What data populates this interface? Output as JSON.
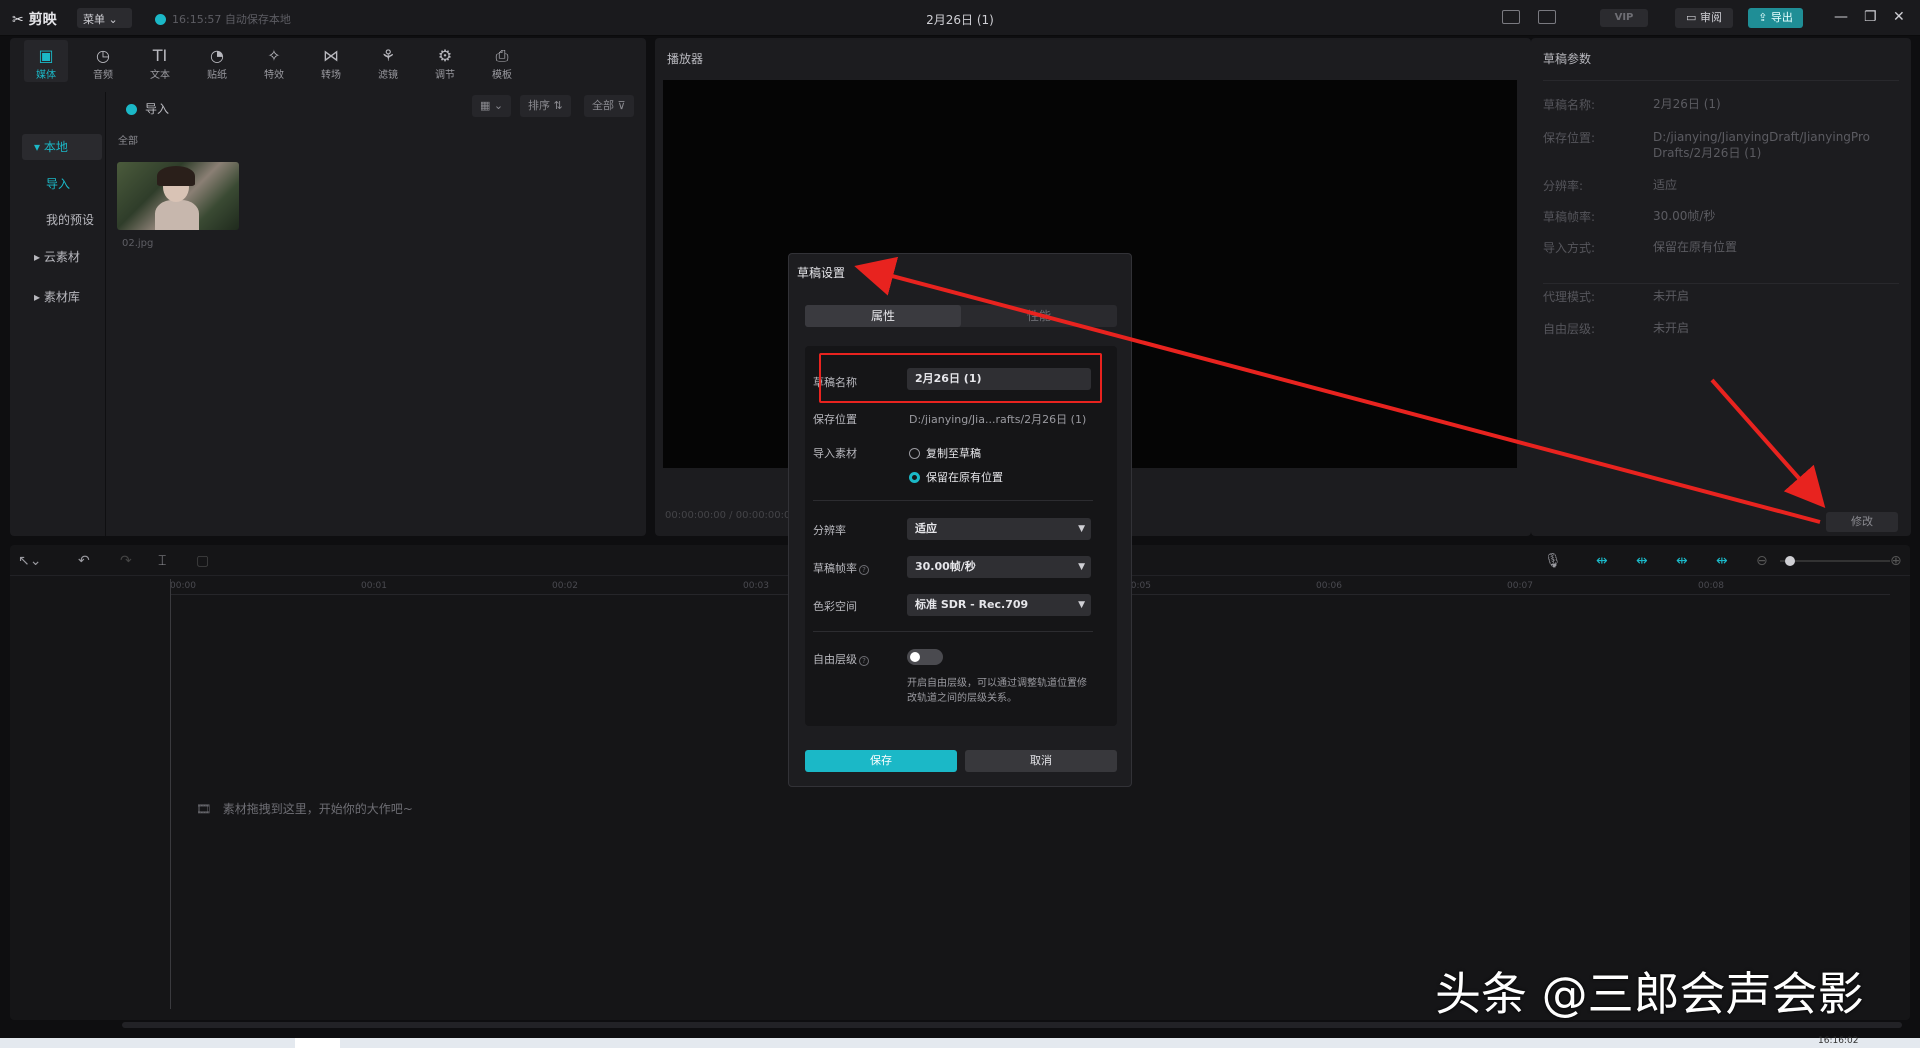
{
  "app": {
    "logo": "剪映",
    "menu_label": "菜单",
    "autosave": "16:15:57 自动保存本地",
    "doc_title": "2月26日 (1)",
    "vip": "VIP",
    "review": "审阅",
    "export": "导出"
  },
  "toolbar": [
    "媒体",
    "音频",
    "文本",
    "贴纸",
    "特效",
    "转场",
    "滤镜",
    "调节",
    "模板"
  ],
  "toolbar_icons": [
    "media-icon",
    "audio-icon",
    "text-icon",
    "sticker-icon",
    "effects-icon",
    "transition-icon",
    "filter-icon",
    "adjust-icon",
    "template-icon"
  ],
  "sidebar": {
    "local": "本地",
    "import": "导入",
    "presets": "我的预设",
    "cloud": "云素材",
    "library": "素材库"
  },
  "media": {
    "import_label": "导入",
    "sort_label": "排序",
    "all_filter": "全部",
    "all_heading": "全部",
    "file_name": "02.jpg"
  },
  "player": {
    "title": "播放器",
    "timecode": "00:00:00:00 / 00:00:00:00"
  },
  "params": {
    "title": "草稿参数",
    "rows": [
      {
        "k": "草稿名称:",
        "v": "2月26日 (1)"
      },
      {
        "k": "保存位置:",
        "v": "D:/jianying/JianyingDraft/JianyingPro Drafts/2月26日 (1)"
      },
      {
        "k": "分辨率:",
        "v": "适应"
      },
      {
        "k": "草稿帧率:",
        "v": "30.00帧/秒"
      },
      {
        "k": "导入方式:",
        "v": "保留在原有位置"
      },
      {
        "k": "代理模式:",
        "v": "未开启"
      },
      {
        "k": "自由层级:",
        "v": "未开启"
      }
    ],
    "modify": "修改"
  },
  "timeline": {
    "ticks": [
      "00:00",
      "00:01",
      "00:02",
      "00:03",
      "00:04",
      "00:05",
      "00:06",
      "00:07",
      "00:08"
    ],
    "drop_hint": "素材拖拽到这里，开始你的大作吧~"
  },
  "dialog": {
    "title": "草稿设置",
    "tab_props": "属性",
    "tab_other": "性能",
    "name_label": "草稿名称",
    "name_value": "2月26日 (1)",
    "path_label": "保存位置",
    "path_value": "D:/jianying/Jia...rafts/2月26日 (1)",
    "import_label": "导入素材",
    "opt_copy": "复制至草稿",
    "opt_keep": "保留在原有位置",
    "res_label": "分辨率",
    "res_value": "适应",
    "fps_label": "草稿帧率",
    "fps_value": "30.00帧/秒",
    "color_label": "色彩空间",
    "color_value": "标准 SDR - Rec.709",
    "free_label": "自由层级",
    "free_desc": "开启自由层级，可以通过调整轨道位置修改轨道之间的层级关系。",
    "save": "保存",
    "cancel": "取消"
  },
  "watermark": "头条 @三郎会声会影",
  "taskbar_time": "16:16:02",
  "colors": {
    "accent": "#1bb8c7",
    "annotation_red": "#e8231f"
  }
}
